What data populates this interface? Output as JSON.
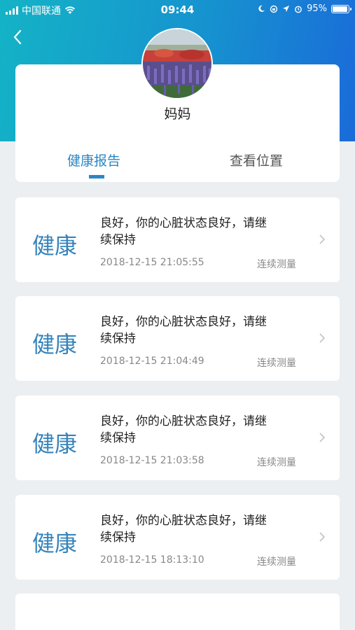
{
  "status_bar": {
    "carrier": "中国联通",
    "time": "09:44",
    "battery": "95%",
    "battery_level": 0.95
  },
  "header": {
    "name": "妈妈",
    "tabs": [
      {
        "label": "健康报告",
        "active": true
      },
      {
        "label": "查看位置",
        "active": false
      }
    ]
  },
  "records": [
    {
      "status": "健康",
      "line1": "良好，你的心脏状态良好，请继",
      "line2": "续保持",
      "time": "2018-12-15 21:05:55",
      "mode": "连续测量"
    },
    {
      "status": "健康",
      "line1": "良好，你的心脏状态良好，请继",
      "line2": "续保持",
      "time": "2018-12-15 21:04:49",
      "mode": "连续测量"
    },
    {
      "status": "健康",
      "line1": "良好，你的心脏状态良好，请继",
      "line2": "续保持",
      "time": "2018-12-15 21:03:58",
      "mode": "连续测量"
    },
    {
      "status": "健康",
      "line1": "良好，你的心脏状态良好，请继",
      "line2": "续保持",
      "time": "2018-12-15 18:13:10",
      "mode": "连续测量"
    }
  ],
  "colors": {
    "accent": "#2b86c4",
    "header_gradient_start": "#14b3c6",
    "header_gradient_end": "#1a6bd9"
  }
}
